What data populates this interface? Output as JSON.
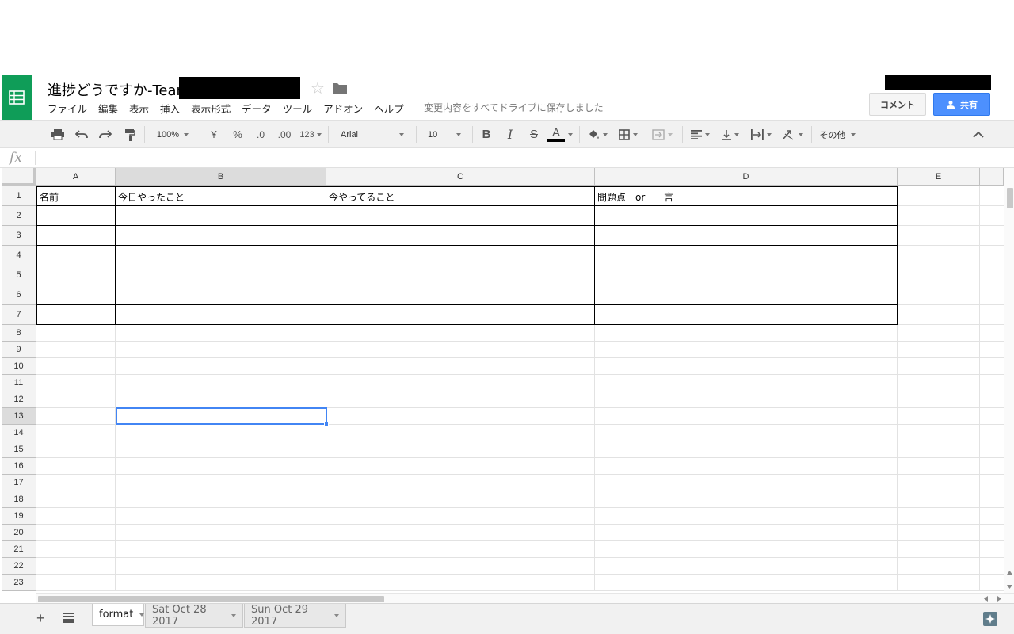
{
  "header": {
    "title": "進捗どうですか-Team",
    "menu": [
      "ファイル",
      "編集",
      "表示",
      "挿入",
      "表示形式",
      "データ",
      "ツール",
      "アドオン",
      "ヘルプ"
    ],
    "save_status": "変更内容をすべてドライブに保存しました",
    "comment_label": "コメント",
    "share_label": "共有"
  },
  "toolbar": {
    "zoom": "100%",
    "currency": "¥",
    "percent": "%",
    "dec_less": ".0",
    "dec_more": ".00",
    "more_formats": "123",
    "font": "Arial",
    "font_size": "10",
    "bold": "B",
    "italic": "I",
    "strike": "S",
    "text_color": "A",
    "more": "その他"
  },
  "formula_bar": {
    "fx": "fx"
  },
  "grid": {
    "columns": [
      "A",
      "B",
      "C",
      "D",
      "E"
    ],
    "rows": [
      "1",
      "2",
      "3",
      "4",
      "5",
      "6",
      "7",
      "8",
      "9",
      "10",
      "11",
      "12",
      "13",
      "14",
      "15",
      "16",
      "17",
      "18",
      "19",
      "20",
      "21",
      "22",
      "23"
    ],
    "header_row": [
      "名前",
      "今日やったこと",
      "今やってること",
      "問題点　or　一言"
    ],
    "selected_cell": "B13"
  },
  "sheets": {
    "tabs": [
      {
        "label": "format",
        "active": true
      },
      {
        "label": "Sat Oct 28 2017",
        "active": false
      },
      {
        "label": "Sun Oct 29 2017",
        "active": false
      }
    ]
  },
  "colors": {
    "brand_green": "#0f9d58",
    "share_blue": "#4d90fe",
    "selection_blue": "#4285f4"
  }
}
